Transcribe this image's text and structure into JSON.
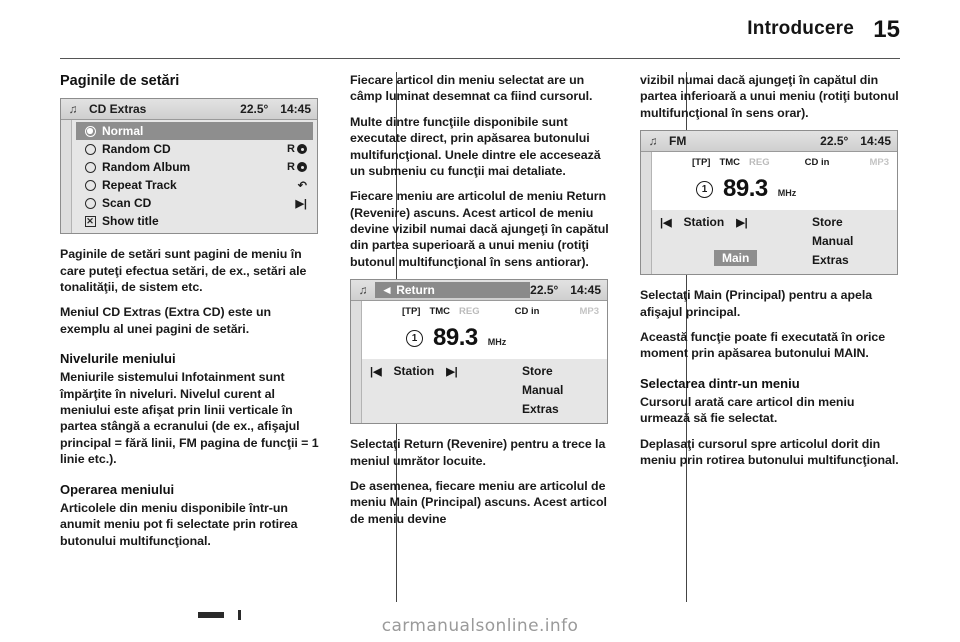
{
  "header": {
    "title": "Introducere",
    "page_number": "15"
  },
  "footer": {
    "watermark": "carmanualsonline.info"
  },
  "columns": {
    "left": {
      "heading": "Paginile de setări",
      "paragraphs": [
        "Paginile de setări sunt pagini de meniu în care puteţi efectua setări, de ex., setări ale tonalităţii, de sistem etc.",
        "Meniul CD Extras (Extra CD) este un exemplu al unei pagini de setări."
      ],
      "subheading_levels": "Nivelurile meniului",
      "levels_paragraphs": [
        "Meniurile sistemului Infotainment sunt împărţite în niveluri. Nivelul curent al meniului este afişat prin linii verticale în partea stângă a ecranului (de ex., afişajul principal = fără linii, FM pagina de funcţii = 1 linie etc.)."
      ],
      "subheading_operation": "Operarea meniului",
      "operation_paragraphs": [
        "Articolele din meniu disponibile într-un anumit meniu pot fi selectate prin rotirea butonului multifuncţional."
      ]
    },
    "middle": {
      "paragraphs": [
        "Fiecare articol din meniu selectat are un câmp luminat desemnat ca fiind cursorul.",
        "Multe dintre funcţiile disponibile sunt executate direct, prin apăsarea butonului multifuncţional. Unele dintre ele accesează un submeniu cu funcţii mai detaliate.",
        "Fiecare meniu are articolul de meniu Return (Revenire) ascuns. Acest articol de meniu devine vizibil numai dacă ajungeţi în capătul din partea superioară a unui meniu (rotiţi butonul multifuncţional în sens antiorar)."
      ],
      "paragraphs_after": [
        "Selectaţi Return (Revenire) pentru a trece la meniul umrător locuite.",
        "De asemenea, fiecare meniu are articolul de meniu Main (Principal) ascuns. Acest articol de meniu devine"
      ]
    },
    "right": {
      "paragraphs_top": [
        "vizibil numai dacă ajungeţi în capătul din partea inferioară a unui meniu (rotiţi butonul multifuncţional în sens orar)."
      ],
      "paragraphs_after": [
        "Selectaţi Main (Principal) pentru a apela afişajul principal.",
        "Această funcţie poate fi executată în orice moment prin apăsarea butonului MAIN."
      ],
      "subheading_selection": "Selectarea dintr-un meniu",
      "selection_paragraphs": [
        "Cursorul arată care articol din meniu urmează să fie selectat.",
        "Deplasaţi cursorul spre articolul dorit din meniu prin rotirea butonului multifuncţional."
      ]
    }
  },
  "displays": {
    "cd_extras": {
      "note_icon": "music-note-icon",
      "title": "CD Extras",
      "temperature": "22.5°",
      "clock": "14:45",
      "items": [
        {
          "marker": "radio-selected",
          "label": "Normal",
          "right": "",
          "selected": true
        },
        {
          "marker": "radio",
          "label": "Random CD",
          "right": "R",
          "right_icon": "disc-icon",
          "selected": false
        },
        {
          "marker": "radio",
          "label": "Random Album",
          "right": "R",
          "right_icon": "disc-icon",
          "selected": false
        },
        {
          "marker": "radio",
          "label": "Repeat Track",
          "right": "",
          "right_icon": "repeat-icon",
          "selected": false
        },
        {
          "marker": "radio",
          "label": "Scan CD",
          "right": "",
          "right_icon": "skip-forward-icon",
          "selected": false
        },
        {
          "marker": "checkbox",
          "label": "Show title",
          "right": "",
          "selected": false
        }
      ]
    },
    "fm_return": {
      "note_icon": "music-note-icon",
      "title": "◄ Return",
      "title_highlighted": true,
      "temperature": "22.5°",
      "clock": "14:45",
      "status": {
        "tp": "[TP]",
        "tmc": "TMC",
        "reg": "REG",
        "cd_in": "CD in",
        "mp3": "MP3"
      },
      "preset": "1",
      "frequency": "89.3",
      "unit": "MHz",
      "station_label": "Station",
      "menu_right": [
        "Store",
        "Manual",
        "Extras"
      ],
      "main_button": ""
    },
    "fm_main": {
      "note_icon": "music-note-icon",
      "title": "FM",
      "title_highlighted": false,
      "temperature": "22.5°",
      "clock": "14:45",
      "status": {
        "tp": "[TP]",
        "tmc": "TMC",
        "reg": "REG",
        "cd_in": "CD in",
        "mp3": "MP3"
      },
      "preset": "1",
      "frequency": "89.3",
      "unit": "MHz",
      "station_label": "Station",
      "menu_right": [
        "Store",
        "Manual",
        "Extras"
      ],
      "main_button": "Main"
    }
  }
}
